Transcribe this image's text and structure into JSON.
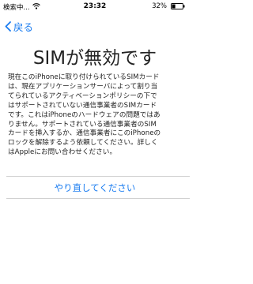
{
  "status_bar": {
    "carrier": "検索中...",
    "time": "23:32",
    "battery_percent": "32%",
    "battery_level": 0.32
  },
  "navigation": {
    "back_label": "戻る"
  },
  "title": "SIMが無効です",
  "message_lines": [
    "現在このiPhoneに取り付けられているSIMカード",
    "は、現在アプリケーションサーバによって割り当",
    "てられているアクティベーションポリシーの下で",
    "はサポートされていない通信事業者のSIMカード",
    "です。これはiPhoneのハードウェアの問題ではあ",
    "りません。サポートされている通信事業者のSIM",
    "カードを挿入するか、通信事業者にこのiPhoneの",
    "ロックを解除するよう依頼してください。詳しく",
    "はAppleにお問い合わせください。"
  ],
  "retry_button": "やり直してください",
  "colors": {
    "accent": "#1a7cf0",
    "text": "#222222",
    "divider": "#cfcfcf"
  }
}
